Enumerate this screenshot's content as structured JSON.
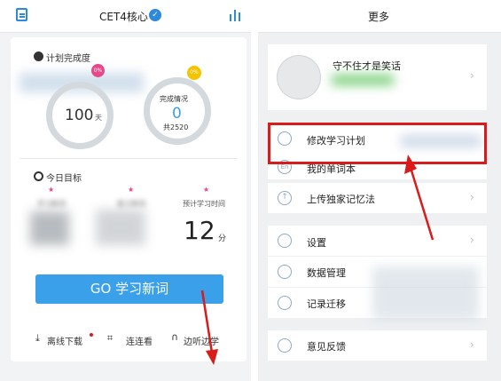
{
  "left": {
    "title": "CET4核心",
    "plan_label": "计划完成度",
    "plan_value": "100",
    "plan_unit": "天",
    "badge_plan": "0%",
    "badge_done": "0%",
    "completion_label": "完成情况",
    "completion_value": "0",
    "completion_total": "共2520",
    "today_label": "今日目标",
    "goal_new": "学习新词",
    "goal_review": "复习单词",
    "goal_time": "预计学习时间",
    "time_value": "12",
    "time_unit": "分",
    "go_button": "GO 学习新词",
    "bottom": [
      "离线下载",
      "连连看",
      "边听边学"
    ]
  },
  "right": {
    "title": "更多",
    "user_name": "守不住才是笑话",
    "menu": [
      {
        "label": "修改学习计划",
        "icon": "tools-icon"
      },
      {
        "label": "我的单词本",
        "icon": "en-icon"
      },
      {
        "label": "上传独家记忆法",
        "icon": "upload-icon"
      },
      {
        "label": "设置",
        "icon": "settings-icon"
      },
      {
        "label": "数据管理",
        "icon": "data-icon"
      },
      {
        "label": "记录迁移",
        "icon": "transfer-icon"
      },
      {
        "label": "意见反馈",
        "icon": "feedback-icon"
      }
    ]
  },
  "colors": {
    "accent": "#3aa0ea",
    "highlight": "#d91b1b",
    "pink": "#e8478a",
    "yellow": "#f5c400"
  }
}
